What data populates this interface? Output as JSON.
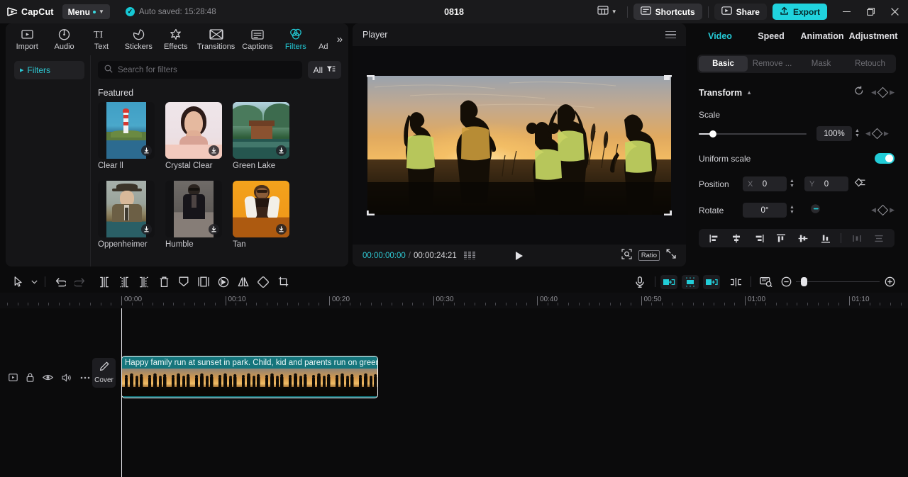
{
  "titlebar": {
    "logo_text": "CapCut",
    "menu_label": "Menu",
    "autosave_text": "Auto saved: 15:28:48",
    "project_title": "0818",
    "shortcuts_label": "Shortcuts",
    "share_label": "Share",
    "export_label": "Export",
    "minimize_label": "─",
    "maximize_label": "❐",
    "close_label": "✕"
  },
  "nav": {
    "items": [
      {
        "label": "Import",
        "icon": "import-icon",
        "active": false
      },
      {
        "label": "Audio",
        "icon": "audio-icon",
        "active": false
      },
      {
        "label": "Text",
        "icon": "text-icon",
        "active": false
      },
      {
        "label": "Stickers",
        "icon": "stickers-icon",
        "active": false
      },
      {
        "label": "Effects",
        "icon": "effects-icon",
        "active": false
      },
      {
        "label": "Transitions",
        "icon": "transitions-icon",
        "active": false
      },
      {
        "label": "Captions",
        "icon": "captions-icon",
        "active": false
      },
      {
        "label": "Filters",
        "icon": "filters-icon",
        "active": true
      },
      {
        "label": "Ad",
        "icon": "adjustment-icon",
        "active": false
      }
    ],
    "more_label": "»"
  },
  "filters_panel": {
    "category_label": "Filters",
    "search_placeholder": "Search for filters",
    "filter_button_label": "All",
    "section_title": "Featured",
    "items": [
      {
        "name": "Clear ll"
      },
      {
        "name": "Crystal Clear"
      },
      {
        "name": "Green Lake"
      },
      {
        "name": "Oppenheimer"
      },
      {
        "name": "Humble"
      },
      {
        "name": "Tan"
      }
    ]
  },
  "player": {
    "title": "Player",
    "current_time": "00:00:00:00",
    "time_separator": "/",
    "total_time": "00:00:24:21",
    "ratio_label": "Ratio"
  },
  "properties": {
    "tabs": [
      {
        "label": "Video",
        "active": true
      },
      {
        "label": "Speed",
        "active": false
      },
      {
        "label": "Animation",
        "active": false
      },
      {
        "label": "Adjustment",
        "active": false
      }
    ],
    "subtabs": [
      {
        "label": "Basic",
        "active": true
      },
      {
        "label": "Remove ...",
        "active": false
      },
      {
        "label": "Mask",
        "active": false
      },
      {
        "label": "Retouch",
        "active": false
      }
    ],
    "transform": {
      "title": "Transform",
      "scale_label": "Scale",
      "scale_value": "100%",
      "scale_percent": 13,
      "uniform_scale_label": "Uniform scale",
      "uniform_scale_on": true,
      "position_label": "Position",
      "position_x_axis": "X",
      "position_x_value": "0",
      "position_y_axis": "Y",
      "position_y_value": "0",
      "rotate_label": "Rotate",
      "rotate_value": "0°"
    }
  },
  "timeline": {
    "ruler_labels": [
      "00:00",
      "00:10",
      "00:20",
      "00:30",
      "00:40",
      "00:50",
      "01:00",
      "01:10"
    ],
    "cover_label": "Cover",
    "clip_title": "Happy family run at sunset in park. Child, kid and parents run on green g",
    "playhead_time": "00:00"
  },
  "colors": {
    "accent": "#20d3de",
    "clip": "#15757c",
    "panel": "#151517",
    "background": "#0b0b0c"
  }
}
